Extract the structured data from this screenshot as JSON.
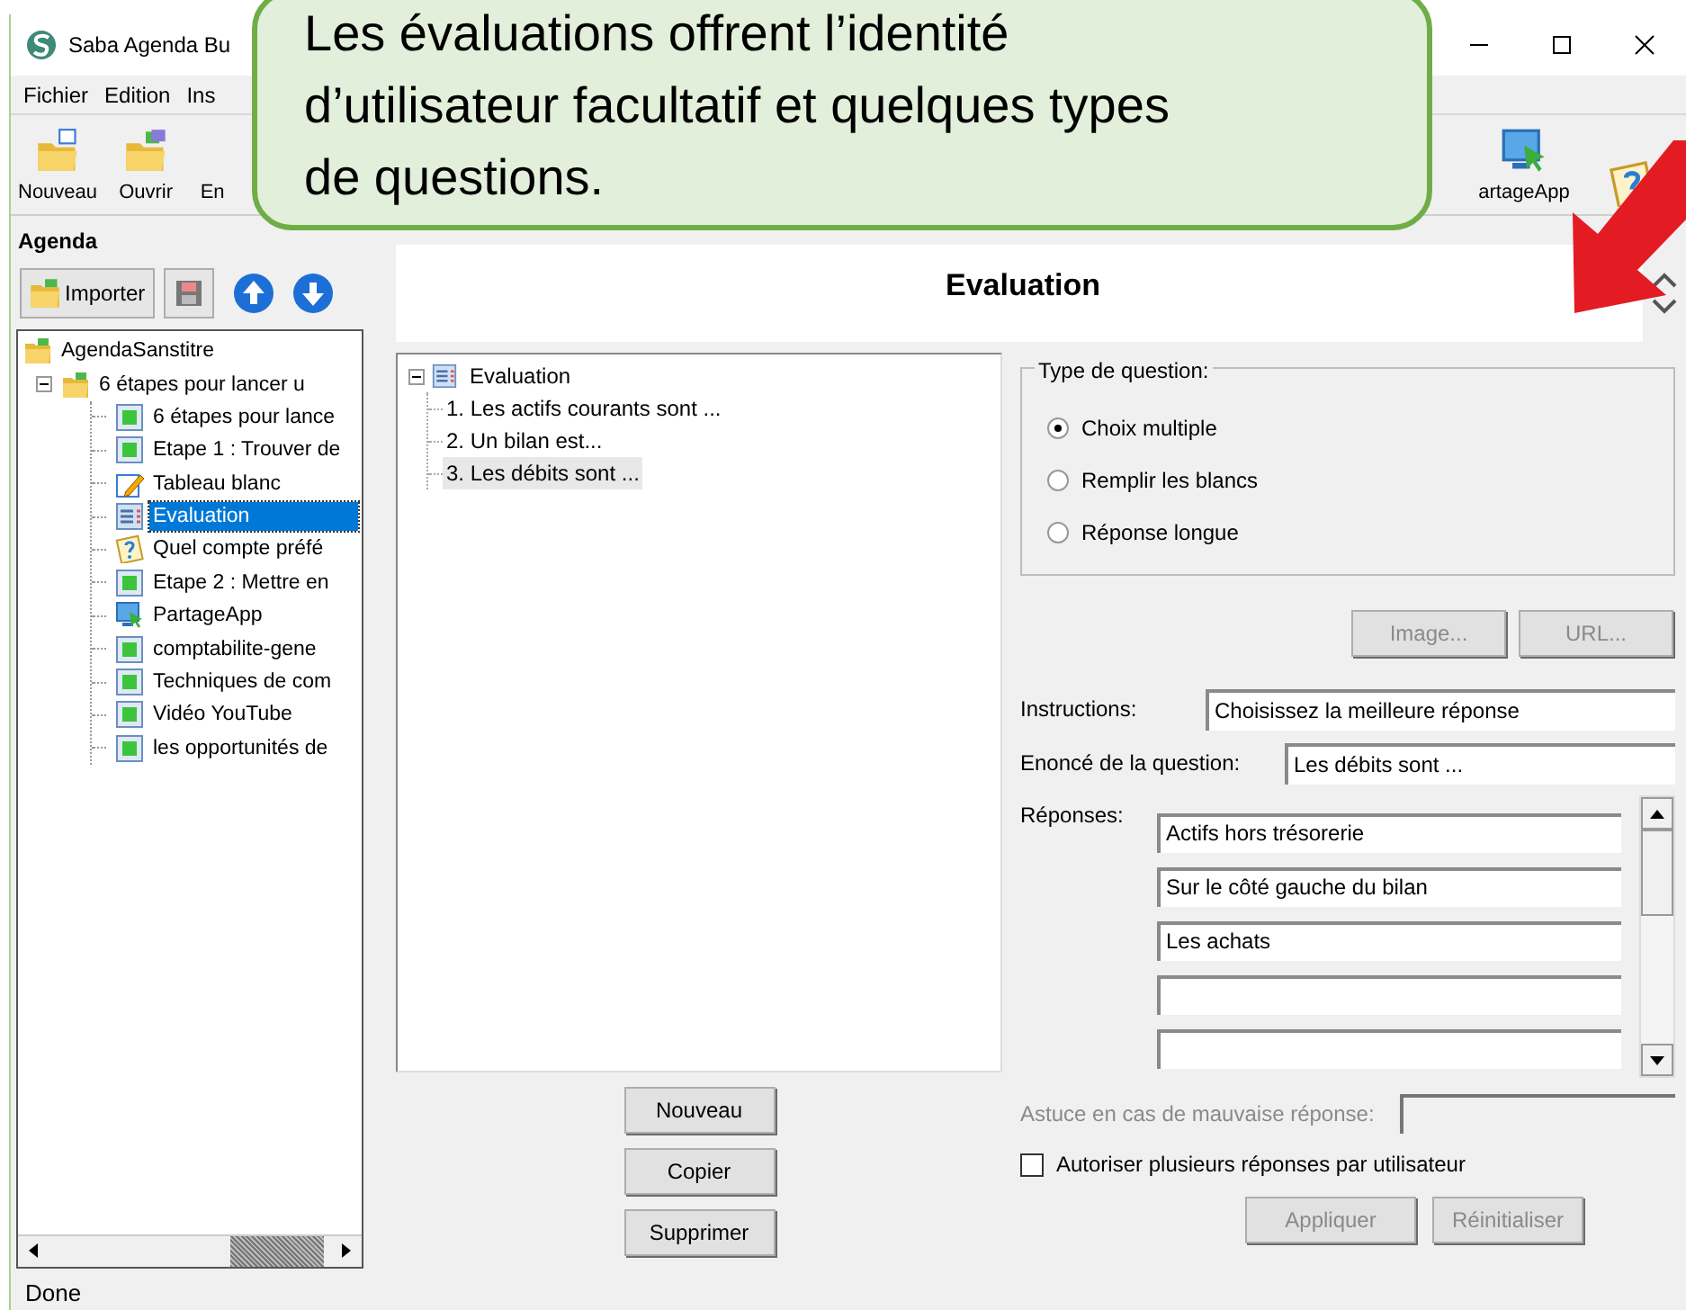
{
  "window": {
    "title": "Saba Agenda Bu"
  },
  "callout": {
    "lines": [
      "Les évaluations offrent l’identité",
      "d’utilisateur facultatif et quelques types",
      "de questions."
    ]
  },
  "menu": [
    "Fichier",
    "Edition",
    "Ins"
  ],
  "toolbar": [
    {
      "label": "Nouveau",
      "kind": "new"
    },
    {
      "label": "Ouvrir",
      "kind": "open"
    },
    {
      "label": "En",
      "kind": "text"
    },
    {
      "label": "artageApp",
      "kind": "share"
    },
    {
      "kind": "quiz"
    }
  ],
  "agenda": {
    "title": "Agenda",
    "import_button": "Importer"
  },
  "tree": {
    "label": "AgendaSanstitre",
    "kind": "folder",
    "children": [
      {
        "label": "6 étapes pour lancer u",
        "kind": "folder",
        "expanded": true,
        "children": [
          {
            "label": "6 étapes pour lance",
            "kind": "page",
            "selected": false
          },
          {
            "label": "Etape 1 : Trouver de",
            "kind": "page",
            "selected": false
          },
          {
            "label": "Tableau blanc",
            "kind": "whiteboard",
            "selected": false
          },
          {
            "label": "Evaluation",
            "kind": "evaluation",
            "selected": true
          },
          {
            "label": "Quel compte préfé",
            "kind": "quiz",
            "selected": false
          },
          {
            "label": "Etape 2 : Mettre en",
            "kind": "page",
            "selected": false
          },
          {
            "label": "PartageApp",
            "kind": "share",
            "selected": false
          },
          {
            "label": "comptabilite-gene",
            "kind": "page",
            "selected": false
          },
          {
            "label": "Techniques de com",
            "kind": "page",
            "selected": false
          },
          {
            "label": "Vidéo YouTube",
            "kind": "page",
            "selected": false
          },
          {
            "label": "les opportunités de",
            "kind": "page",
            "selected": false
          }
        ]
      }
    ]
  },
  "header": {
    "title": "Evaluation"
  },
  "questions": {
    "root": "Evaluation",
    "items": [
      {
        "label": "1. Les actifs courants sont ...",
        "selected": false
      },
      {
        "label": "2. Un bilan est...",
        "selected": false
      },
      {
        "label": "3. Les débits sont ...",
        "selected": true
      }
    ]
  },
  "list_buttons": [
    "Nouveau",
    "Copier",
    "Supprimer"
  ],
  "question_type": {
    "title": "Type de question:",
    "options": [
      {
        "label": "Choix multiple",
        "selected": true
      },
      {
        "label": "Remplir les blancs",
        "selected": false
      },
      {
        "label": "Réponse longue",
        "selected": false
      }
    ]
  },
  "media_buttons": [
    {
      "label": "Image...",
      "disabled": true
    },
    {
      "label": "URL...",
      "disabled": true
    }
  ],
  "instructions": {
    "label": "Instructions:",
    "value": "Choisissez la meilleure réponse"
  },
  "statement": {
    "label": "Enoncé de la question:",
    "value": "Les débits sont ..."
  },
  "answers": {
    "label": "Réponses:",
    "fields": [
      {
        "kind": "filled",
        "value": "Actifs hors trésorerie"
      },
      {
        "kind": "filled",
        "value": "Sur le côté gauche du bilan"
      },
      {
        "kind": "filled",
        "value": "Les achats"
      },
      {
        "kind": "empty"
      },
      {
        "kind": "empty"
      }
    ]
  },
  "hint": {
    "label": "Astuce en cas de mauvaise réponse:",
    "disabled": true
  },
  "multiple_answers": {
    "label": "Autoriser plusieurs réponses par utilisateur",
    "checked": false
  },
  "action_buttons": [
    {
      "label": "Appliquer",
      "disabled": true
    },
    {
      "label": "Réinitialiser",
      "disabled": true
    }
  ],
  "status_bar": "Done"
}
